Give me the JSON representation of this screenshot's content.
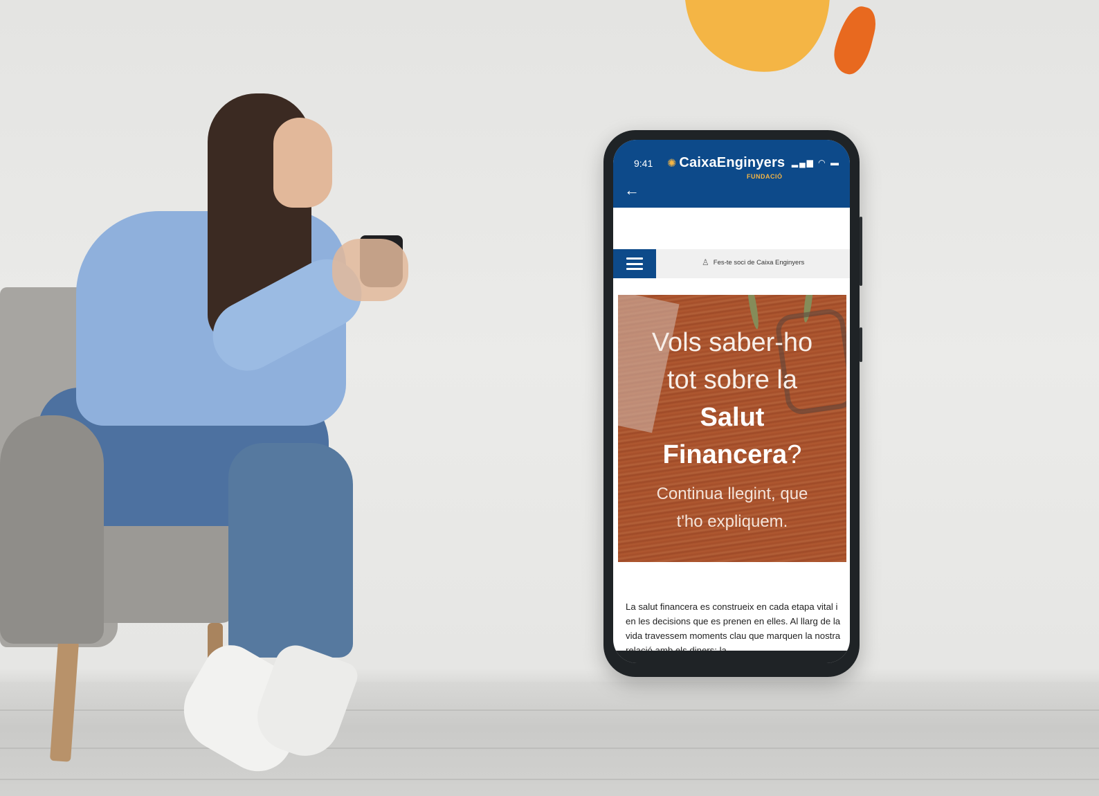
{
  "colors": {
    "brand_blue": "#0d4a8a",
    "brand_yellow": "#f4b545",
    "brand_orange": "#e8691f"
  },
  "phone": {
    "status": {
      "time": "9:41",
      "icons": "signal wifi battery"
    },
    "header": {
      "brand_name": "CaixaEnginyers",
      "brand_sub": "FUNDACIÓ",
      "back_icon": "arrow-left-icon"
    },
    "nav": {
      "menu_icon": "hamburger-menu-icon",
      "member_icon": "user-add-icon",
      "member_link": "Fes-te soci de Caixa Enginyers"
    },
    "hero": {
      "line1": "Vols saber-ho",
      "line2": "tot sobre la",
      "line3": "Salut",
      "line4": "Financera",
      "line4_suffix": "?",
      "subtitle_line1": "Continua llegint, que",
      "subtitle_line2": "t'ho expliquem."
    },
    "article": {
      "intro": "La salut financera es construeix en cada etapa vital i en les decisions que es prenen en elles. Al llarg de la vida travessem moments clau que marquen la nostra relació amb els diners: la"
    }
  }
}
